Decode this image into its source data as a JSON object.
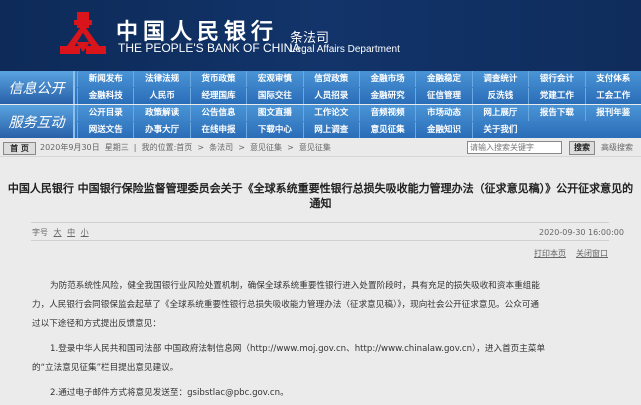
{
  "header": {
    "logo_cn": "中国人民银行",
    "logo_en": "THE PEOPLE'S BANK OF CHINA",
    "dept_cn": "条法司",
    "dept_en": "Legal Affairs Department",
    "logo_color": "#d9141b"
  },
  "nav": {
    "blocks": [
      {
        "label": "信息公开",
        "rows": [
          [
            "新闻发布",
            "法律法规",
            "货币政策",
            "宏观审慎",
            "信贷政策",
            "金融市场",
            "金融稳定",
            "调查统计",
            "银行会计",
            "支付体系"
          ],
          [
            "金融科技",
            "人民币",
            "经理国库",
            "国际交往",
            "人员招录",
            "金融研究",
            "征信管理",
            "反洗钱",
            "党建工作",
            "工会工作"
          ]
        ]
      },
      {
        "label": "服务互动",
        "rows": [
          [
            "公开目录",
            "政策解读",
            "公告信息",
            "图文直播",
            "工作论文",
            "音频视频",
            "市场动态",
            "网上展厅",
            "报告下载",
            "报刊年鉴"
          ],
          [
            "网送文告",
            "办事大厅",
            "在线申报",
            "下载中心",
            "网上调查",
            "意见征集",
            "金融知识",
            "关于我们"
          ]
        ]
      }
    ]
  },
  "crumb": {
    "home": "首 页",
    "text": "2020年9月30日  星期三  |  我的位置:首页  >  条法司  >  意见征集  >  意见征集",
    "search_placeholder": "请输入搜索关键字",
    "search_btn": "搜索",
    "advanced": "高级搜索"
  },
  "article": {
    "title_line1": "中国人民银行 中国银行保险监督管理委员会关于《全球系统重要性银行总损失吸收能力管理办法（征求意见稿）》公开征求意见的",
    "title_line2": "通知",
    "font_label": "字号",
    "font_sizes": [
      "大",
      "中",
      "小"
    ],
    "date": "2020-09-30 16:00:00",
    "print": "打印本页",
    "close": "关闭窗口",
    "para1": [
      "为防范系统性风险，健全我国银行业风险处置机制，确保全球系统重要性银行进入处置阶段时，具有充足的损失吸收和资本重组能",
      "力，人民银行会同银保监会起草了《全球系统重要性银行总损失吸收能力管理办法（征求意见稿）》，现向社会公开征求意见。公众可通",
      "过以下途径和方式提出反馈意见："
    ],
    "para2": [
      "1.登录中华人民共和国司法部 中国政府法制信息网（http://www.moj.gov.cn、http://www.chinalaw.gov.cn），进入首页主菜单",
      "的“立法意见征集”栏目提出意见建议。"
    ],
    "para3": [
      "2.通过电子邮件方式将意见发送至：gsibstlac@pbc.gov.cn。"
    ]
  }
}
